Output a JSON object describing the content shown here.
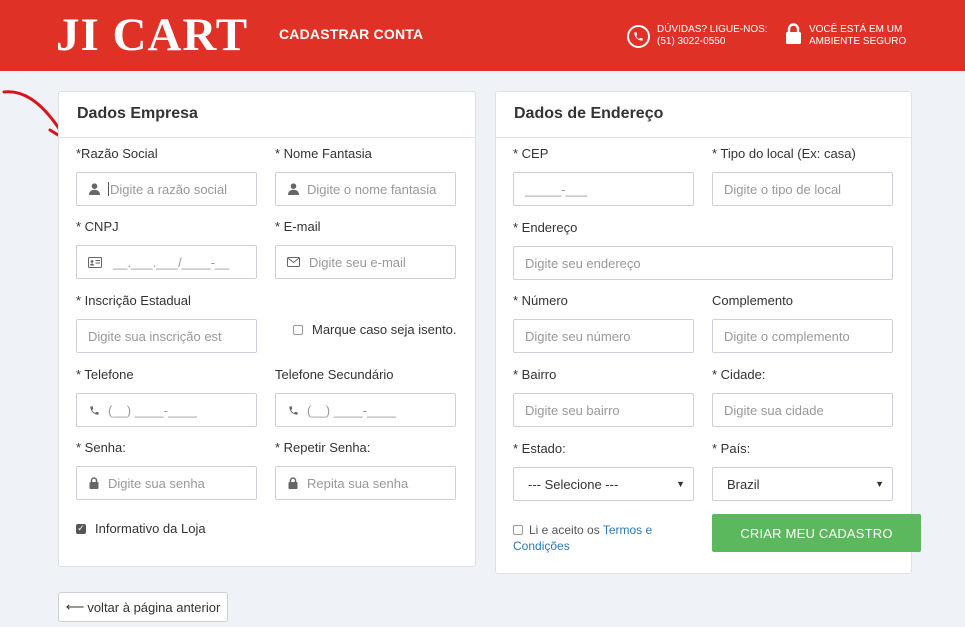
{
  "header": {
    "logo": "JI CART",
    "page_title": "CADASTRAR CONTA",
    "help_line1": "DÚVIDAS? LIGUE-NOS:",
    "help_line2": "(51) 3022-0550",
    "secure_line1": "VOCÊ ESTÁ EM UM",
    "secure_line2": "AMBIENTE SEGURO"
  },
  "empresa": {
    "title": "Dados Empresa",
    "razao_label": "*Razão Social",
    "razao_placeholder": "Digite a razão social",
    "fantasia_label": "* Nome Fantasia",
    "fantasia_placeholder": "Digite o nome fantasia",
    "cnpj_label": "* CNPJ",
    "cnpj_mask": "__.___.___/____-__",
    "email_label": "* E-mail",
    "email_placeholder": "Digite seu e-mail",
    "ie_label": "* Inscrição Estadual",
    "ie_placeholder": "Digite sua inscrição est",
    "isento_label": "Marque caso seja isento.",
    "telefone_label": "* Telefone",
    "telefone_mask": "(__) ____-____",
    "telefone2_label": "Telefone Secundário",
    "telefone2_mask": "(__) ____-____",
    "senha_label": "* Senha:",
    "senha_placeholder": "Digite sua senha",
    "repetir_label": "* Repetir Senha:",
    "repetir_placeholder": "Repita sua senha",
    "informativo_label": "Informativo da Loja"
  },
  "endereco": {
    "title": "Dados de Endereço",
    "cep_label": "* CEP",
    "cep_mask": "_____-___",
    "tipo_label": "* Tipo do local (Ex: casa)",
    "tipo_placeholder": "Digite o tipo de local",
    "endereco_label": "* Endereço",
    "endereco_placeholder": "Digite seu endereço",
    "numero_label": "* Número",
    "numero_placeholder": "Digite seu número",
    "complemento_label": "Complemento",
    "complemento_placeholder": "Digite o complemento",
    "bairro_label": "* Bairro",
    "bairro_placeholder": "Digite seu bairro",
    "cidade_label": "* Cidade:",
    "cidade_placeholder": "Digite sua cidade",
    "estado_label": "* Estado:",
    "estado_value": "--- Selecione ---",
    "pais_label": "* País:",
    "pais_value": "Brazil",
    "terms_text": "Li e aceito os ",
    "terms_link1": "Termos e",
    "terms_link2": "Condições",
    "submit_label": "CRIAR MEU CADASTRO"
  },
  "footer": {
    "back_label": "voltar à página anterior"
  },
  "colors": {
    "brand_red": "#e03127",
    "success_green": "#5cb85c",
    "link_blue": "#2a7ab0"
  }
}
